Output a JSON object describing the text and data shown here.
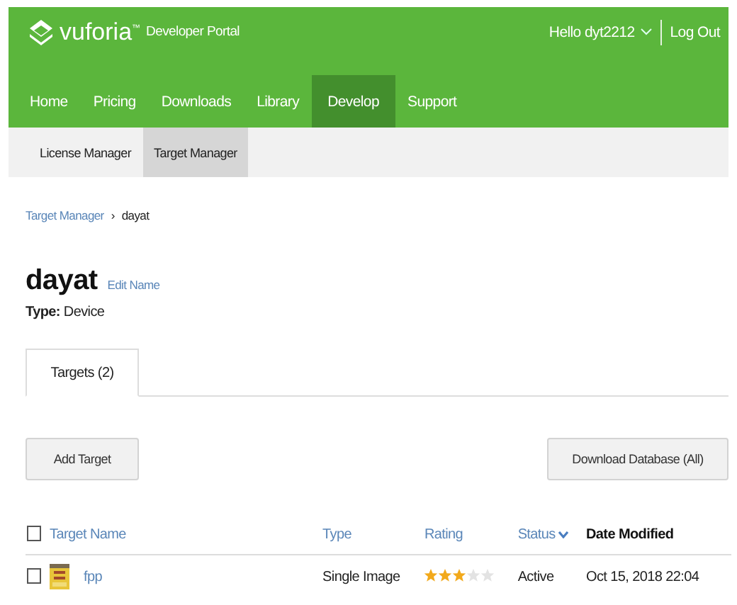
{
  "header": {
    "logo": "vuforia",
    "logo_tm": "™",
    "subtitle": "Developer Portal",
    "greeting": "Hello dyt2212",
    "logout": "Log Out"
  },
  "nav": [
    {
      "label": "Home",
      "selected": false
    },
    {
      "label": "Pricing",
      "selected": false
    },
    {
      "label": "Downloads",
      "selected": false
    },
    {
      "label": "Library",
      "selected": false
    },
    {
      "label": "Develop",
      "selected": true
    },
    {
      "label": "Support",
      "selected": false
    }
  ],
  "subnav": [
    {
      "label": "License Manager",
      "selected": false
    },
    {
      "label": "Target Manager",
      "selected": true
    }
  ],
  "breadcrumb": {
    "link": "Target Manager",
    "separator": "›",
    "current": "dayat"
  },
  "database": {
    "name": "dayat",
    "edit": "Edit Name",
    "type_label": "Type:",
    "type": "Device"
  },
  "tabs": [
    {
      "label": "Targets (2)",
      "selected": true
    }
  ],
  "buttons": {
    "add": "Add Target",
    "download": "Download Database (All)"
  },
  "table": {
    "select_all_checked": false,
    "columns": [
      {
        "label": "Target Name",
        "kind": "link"
      },
      {
        "label": "Type",
        "kind": "link"
      },
      {
        "label": "Rating",
        "kind": "link"
      },
      {
        "label": "Status",
        "kind": "sort"
      },
      {
        "label": "Date Modified",
        "kind": "active"
      }
    ],
    "rows": [
      {
        "name": "fpp",
        "type": "Single Image",
        "stars": 3,
        "status": "Active",
        "date": "Oct 15, 2018 22:04",
        "checked": false
      }
    ]
  }
}
